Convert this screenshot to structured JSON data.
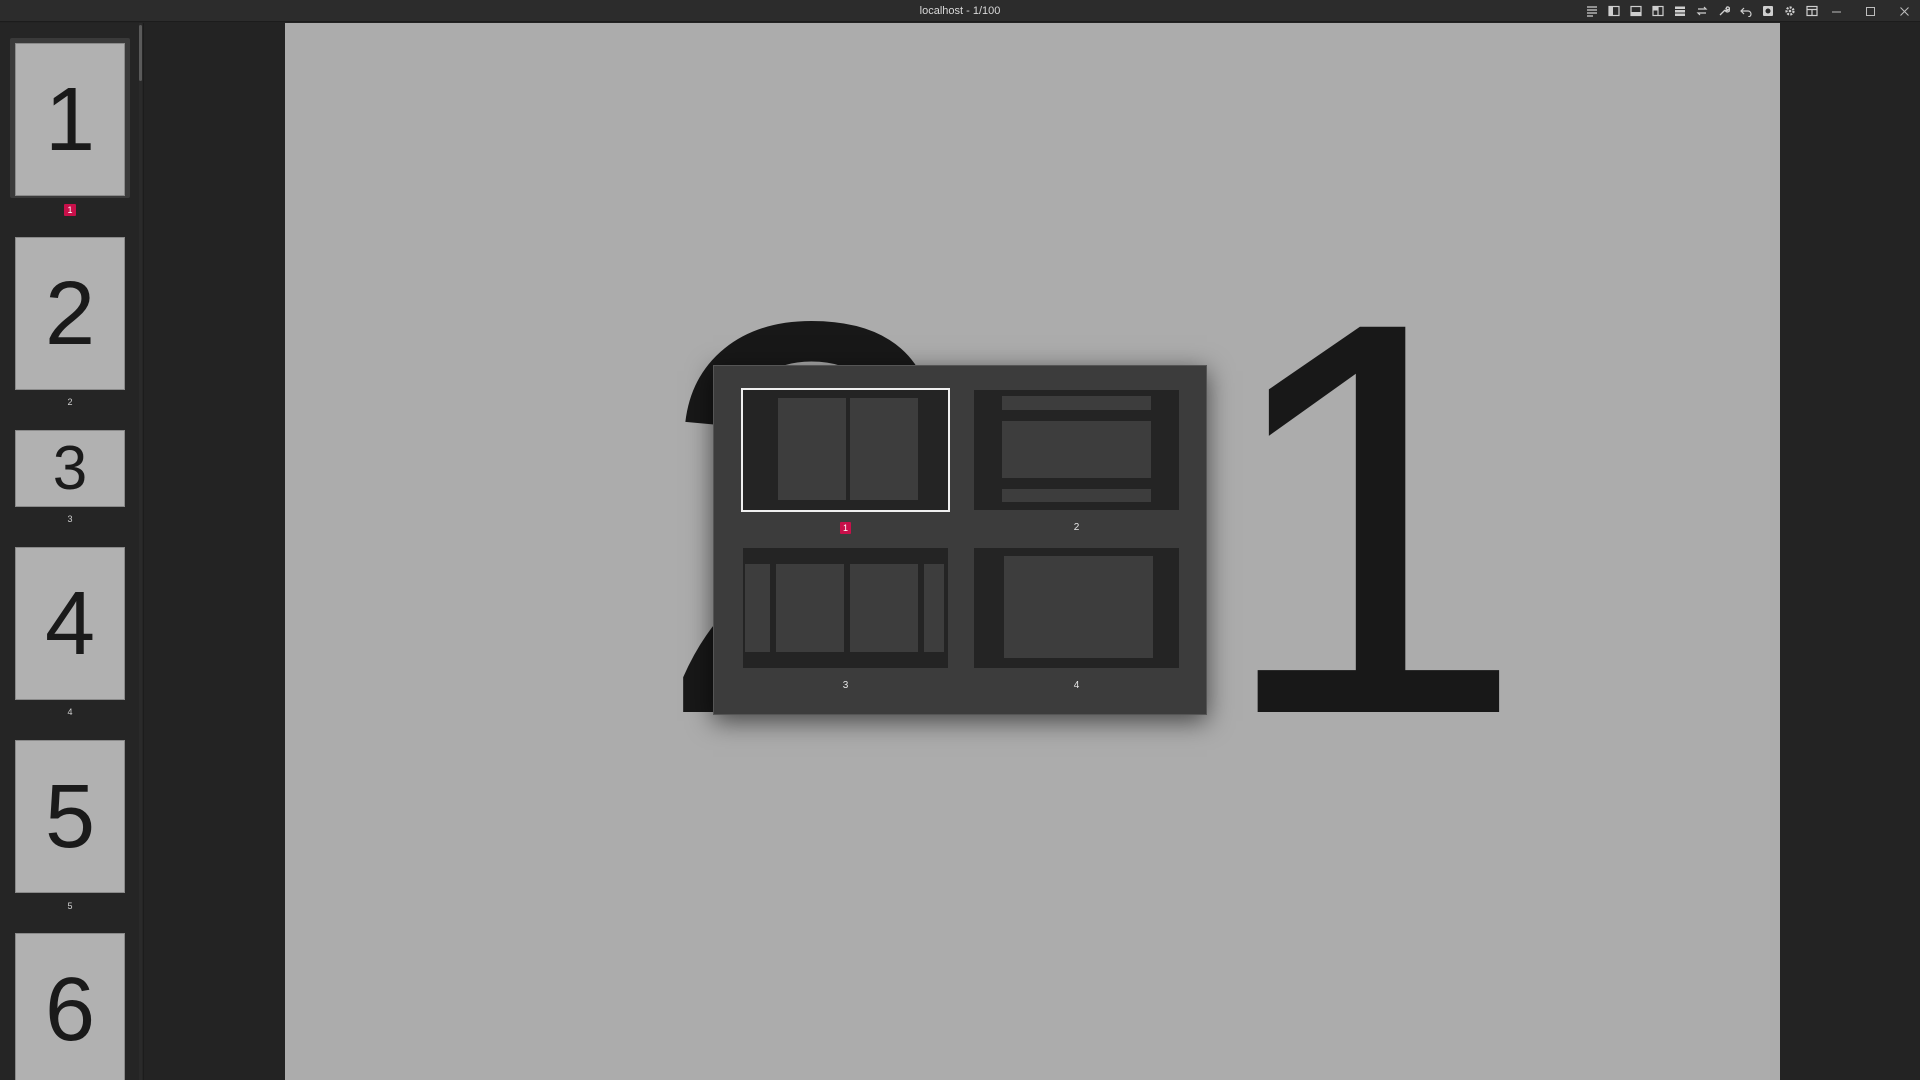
{
  "window": {
    "title": "localhost - 1/100",
    "toolbar_icons": [
      "text-align-icon",
      "sidebar-left-icon",
      "panel-bottom-icon",
      "split-view-icon",
      "list-icon",
      "swap-icon",
      "wrench-icon",
      "undo-icon",
      "record-icon",
      "gear-icon",
      "layout-icon"
    ],
    "controls": [
      "minimize-icon",
      "maximize-icon",
      "close-icon"
    ]
  },
  "sidebar": {
    "thumbnails": [
      {
        "digit": "1",
        "label": "1",
        "selected": true
      },
      {
        "digit": "2",
        "label": "2",
        "selected": false
      },
      {
        "digit": "3",
        "label": "3",
        "selected": false
      },
      {
        "digit": "4",
        "label": "4",
        "selected": false
      },
      {
        "digit": "5",
        "label": "5",
        "selected": false
      },
      {
        "digit": "6",
        "label": "6",
        "selected": false
      }
    ]
  },
  "viewer": {
    "left_digit": "2",
    "right_digit": "1"
  },
  "layout_popup": {
    "options": [
      {
        "label": "1",
        "selected": true
      },
      {
        "label": "2",
        "selected": false
      },
      {
        "label": "3",
        "selected": false
      },
      {
        "label": "4",
        "selected": false
      }
    ],
    "accent_color": "#c8104a"
  }
}
